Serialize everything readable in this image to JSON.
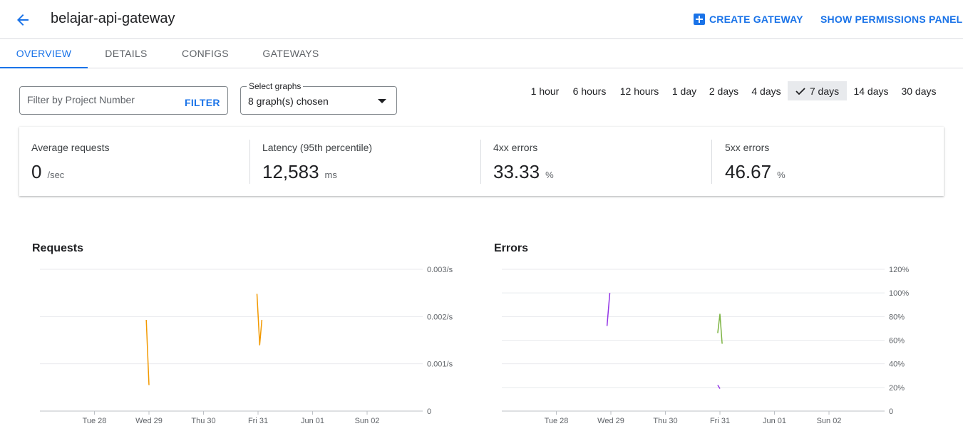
{
  "header": {
    "title": "belajar-api-gateway",
    "back_icon": "arrow-back-icon",
    "create_gateway_label": "CREATE GATEWAY",
    "show_permissions_label": "SHOW PERMISSIONS PANEL"
  },
  "tabs": [
    {
      "label": "OVERVIEW",
      "active": true
    },
    {
      "label": "DETAILS",
      "active": false
    },
    {
      "label": "CONFIGS",
      "active": false
    },
    {
      "label": "GATEWAYS",
      "active": false
    }
  ],
  "filter": {
    "placeholder": "Filter by Project Number",
    "value": "",
    "button_label": "FILTER"
  },
  "graph_select": {
    "label": "Select graphs",
    "value": "8 graph(s) chosen"
  },
  "time_ranges": [
    {
      "label": "1 hour",
      "selected": false
    },
    {
      "label": "6 hours",
      "selected": false
    },
    {
      "label": "12 hours",
      "selected": false
    },
    {
      "label": "1 day",
      "selected": false
    },
    {
      "label": "2 days",
      "selected": false
    },
    {
      "label": "4 days",
      "selected": false
    },
    {
      "label": "7 days",
      "selected": true
    },
    {
      "label": "14 days",
      "selected": false
    },
    {
      "label": "30 days",
      "selected": false
    }
  ],
  "metrics": [
    {
      "label": "Average requests",
      "value": "0",
      "unit": "/sec"
    },
    {
      "label": "Latency (95th percentile)",
      "value": "12,583",
      "unit": "ms"
    },
    {
      "label": "4xx errors",
      "value": "33.33",
      "unit": "%"
    },
    {
      "label": "5xx errors",
      "value": "46.67",
      "unit": "%"
    }
  ],
  "colors": {
    "accent": "#1a73e8",
    "requests_line": "#f29900",
    "errors_purple": "#9334e6",
    "errors_green": "#7cb342"
  },
  "chart_data": [
    {
      "type": "line",
      "title": "Requests",
      "x_ticks": [
        "Tue 28",
        "Wed 29",
        "Thu 30",
        "Fri 31",
        "Jun 01",
        "Sun 02"
      ],
      "y_ticks": [
        "0",
        "0.001/s",
        "0.002/s",
        "0.003/s"
      ],
      "ylim": [
        0,
        0.003
      ],
      "grid": true,
      "series": [
        {
          "color": "#f29900",
          "segments": [
            [
              [
                0.95,
                0.00193
              ],
              [
                1.0,
                0.00055
              ]
            ],
            [
              [
                2.98,
                0.00248
              ],
              [
                3.03,
                0.0014
              ],
              [
                3.07,
                0.00193
              ]
            ]
          ]
        }
      ]
    },
    {
      "type": "line",
      "title": "Errors",
      "x_ticks": [
        "Tue 28",
        "Wed 29",
        "Thu 30",
        "Fri 31",
        "Jun 01",
        "Sun 02"
      ],
      "y_ticks": [
        "0",
        "20%",
        "40%",
        "60%",
        "80%",
        "100%",
        "120%"
      ],
      "ylim": [
        0,
        120
      ],
      "grid": true,
      "series": [
        {
          "color": "#9334e6",
          "segments": [
            [
              [
                0.93,
                72
              ],
              [
                0.98,
                100
              ]
            ],
            [
              [
                2.96,
                22
              ],
              [
                3.0,
                19
              ]
            ]
          ]
        },
        {
          "color": "#7cb342",
          "segments": [
            [
              [
                2.96,
                66
              ],
              [
                3.0,
                82
              ],
              [
                3.04,
                57
              ]
            ]
          ]
        }
      ]
    }
  ]
}
